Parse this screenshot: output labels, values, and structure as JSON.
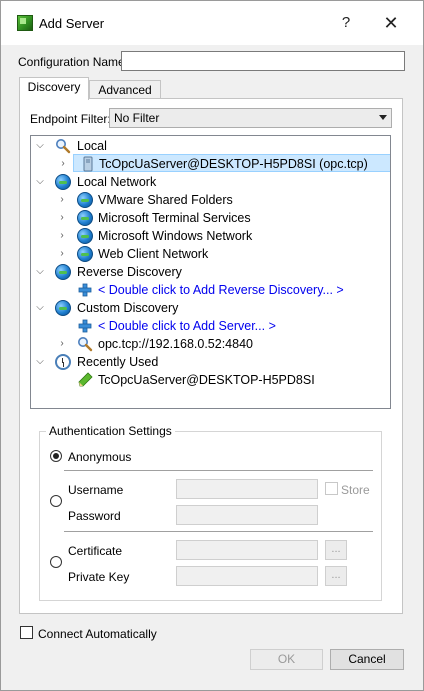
{
  "window": {
    "title": "Add Server",
    "help_label": "?",
    "close_label": "✕"
  },
  "config": {
    "label": "Configuration Name",
    "value": ""
  },
  "tabs": [
    {
      "label": "Discovery"
    },
    {
      "label": "Advanced"
    }
  ],
  "filter": {
    "label": "Endpoint Filter:",
    "value": "No Filter"
  },
  "tree": {
    "local": "Local",
    "local_server": "TcOpcUaServer@DESKTOP-H5PD8SI (opc.tcp)",
    "local_network": "Local Network",
    "vmware": "VMware Shared Folders",
    "ms_terminal": "Microsoft Terminal Services",
    "ms_windows": "Microsoft Windows Network",
    "web_client": "Web Client Network",
    "reverse": "Reverse Discovery",
    "reverse_add": "< Double click to Add Reverse Discovery... >",
    "custom": "Custom Discovery",
    "custom_add": "< Double click to Add Server... >",
    "custom_opc": "opc.tcp://192.168.0.52:4840",
    "recent": "Recently Used",
    "recent_item": "TcOpcUaServer@DESKTOP-H5PD8SI"
  },
  "auth": {
    "title": "Authentication Settings",
    "anonymous": "Anonymous",
    "username": "Username",
    "password": "Password",
    "store": "Store",
    "certificate": "Certificate",
    "private_key": "Private Key",
    "browse": "..."
  },
  "footer": {
    "connect_auto": "Connect Automatically",
    "ok": "OK",
    "cancel": "Cancel"
  }
}
